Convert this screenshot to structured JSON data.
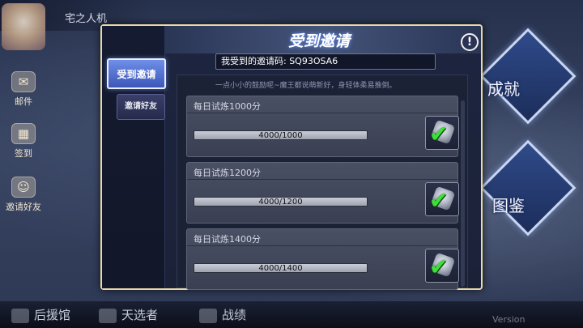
{
  "header": {
    "player_name": "宅之人机"
  },
  "side_menu": [
    {
      "label": "邮件",
      "icon": "mail-icon",
      "glyph": "✉"
    },
    {
      "label": "签到",
      "icon": "calendar-icon",
      "glyph": "▦"
    },
    {
      "label": "邀请好友",
      "icon": "friends-icon",
      "glyph": "☺"
    }
  ],
  "right_menu": [
    {
      "label": "成就"
    },
    {
      "label": "图鉴"
    }
  ],
  "bottom_nav": [
    {
      "label": "后援馆"
    },
    {
      "label": "天选者"
    },
    {
      "label": "战绩"
    }
  ],
  "version_text": "Version",
  "dialog": {
    "title": "受到邀请",
    "info_glyph": "!",
    "tabs": [
      {
        "label": "受到邀请",
        "active": true
      },
      {
        "label": "邀请好友",
        "active": false
      }
    ],
    "invite_code_text": "我受到的邀请码: SQ93OSA6",
    "hint": "一点小小的鼓励呢~魔王都说萌新好，身轻体柔易推倒。",
    "tasks": [
      {
        "title": "每日试炼1000分",
        "progress_text": "4000/1000",
        "progress": 1.0,
        "claimed": true
      },
      {
        "title": "每日试炼1200分",
        "progress_text": "4000/1200",
        "progress": 1.0,
        "claimed": true
      },
      {
        "title": "每日试炼1400分",
        "progress_text": "4000/1400",
        "progress": 1.0,
        "claimed": true
      }
    ],
    "check_glyph": "✔"
  },
  "colors": {
    "accent_blue": "#5b78d8",
    "border_gold": "#e8d9a8",
    "check_green": "#3de03a"
  }
}
